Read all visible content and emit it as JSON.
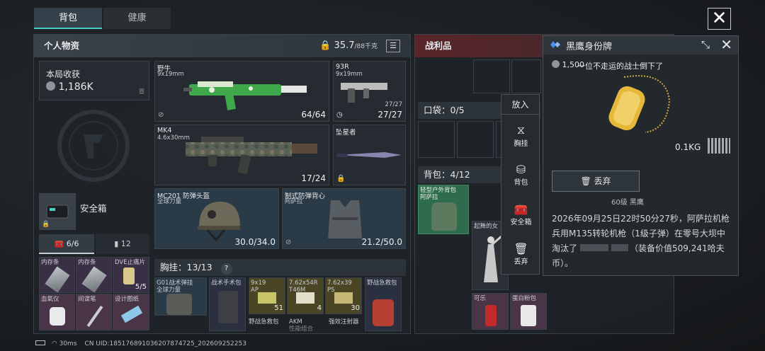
{
  "tabs": {
    "bag": "背包",
    "health": "健康"
  },
  "personal": {
    "title": "个人物资",
    "weight_value": "35.7",
    "weight_max": "/88千克"
  },
  "loot": {
    "title": "战利品"
  },
  "earnings": {
    "label": "本局收获",
    "value": "1,186K"
  },
  "safebox": {
    "label": "安全箱"
  },
  "case_tabs": {
    "a": "6/6",
    "b": "12"
  },
  "small_items": [
    {
      "name": "内存条"
    },
    {
      "name": "内存条"
    },
    {
      "name": "DVE止痛片",
      "count": "5/5"
    },
    {
      "name": "血氧仪"
    },
    {
      "name": "间谍笔"
    },
    {
      "name": "设计图纸"
    }
  ],
  "weapons": {
    "w1": {
      "name": "野牛",
      "ammo": "9x19mm",
      "count": "64/64"
    },
    "w2": {
      "name": "93R",
      "ammo": "9x19mm",
      "count": "27/27",
      "count2": "27/27"
    },
    "w3": {
      "name": "MK4",
      "ammo": "4.6x30mm",
      "count": "17/24"
    },
    "w4": {
      "name": "坠星者"
    }
  },
  "helmet": {
    "name": "MC201 防弹头盔",
    "sub": "全球力量",
    "durability": "30.0/34.0"
  },
  "armor": {
    "name": "制式防弹背心",
    "sub": "阿萨拉",
    "durability": "21.2/50.0"
  },
  "chest": {
    "label": "胸挂：",
    "value": "13/13",
    "help": "?"
  },
  "chest_items": [
    {
      "name": "G01战术弹挂",
      "sub": "全球力量"
    },
    {
      "name": "战术手术包"
    },
    {
      "name": "9x19",
      "sub": "AP",
      "count": "51"
    },
    {
      "name": "7.62x54R",
      "sub": "T46M",
      "count": "4"
    },
    {
      "name": "7.62x39",
      "sub": "PS",
      "count": "30"
    },
    {
      "name": "野战急救包"
    }
  ],
  "chest_row2": [
    "野战急救包",
    "AKM",
    "性能组合",
    "强效注射器"
  ],
  "pocket": {
    "label": "口袋：",
    "value": "0/5"
  },
  "backpack": {
    "label": "背包：",
    "value": "4/12",
    "item": "轻型户外背包",
    "item_sub": "阿萨拉"
  },
  "loot_items": {
    "dancer": "起舞的女",
    "cola": "可乐",
    "protein": "蛋白粉包"
  },
  "context_menu": {
    "title": "放入",
    "items": [
      "胸挂",
      "背包",
      "安全箱",
      "丢弃"
    ]
  },
  "detail": {
    "title": "黑鹰身份牌",
    "price": "1,500",
    "desc": "一位不走运的战士倒下了",
    "weight": "0.1KG",
    "discard": "丢弃",
    "level": "60级 黑鹰",
    "story": "2026年09月25日22时50分27秒，阿萨拉机枪兵用M135转轮机枪（1级子弹）在零号大坝中淘汰了",
    "story_tail": "（装备价值509,241哈夫币）。"
  },
  "status": {
    "ping": "30ms",
    "uid": "CN UID:1851768910362078747​25_202609252253"
  },
  "colors": {
    "accent": "#4bd0c6",
    "loot_red": "#6a2a2e",
    "item_green": "#2f6b4d",
    "detail_blue": "#4c8ff0"
  }
}
